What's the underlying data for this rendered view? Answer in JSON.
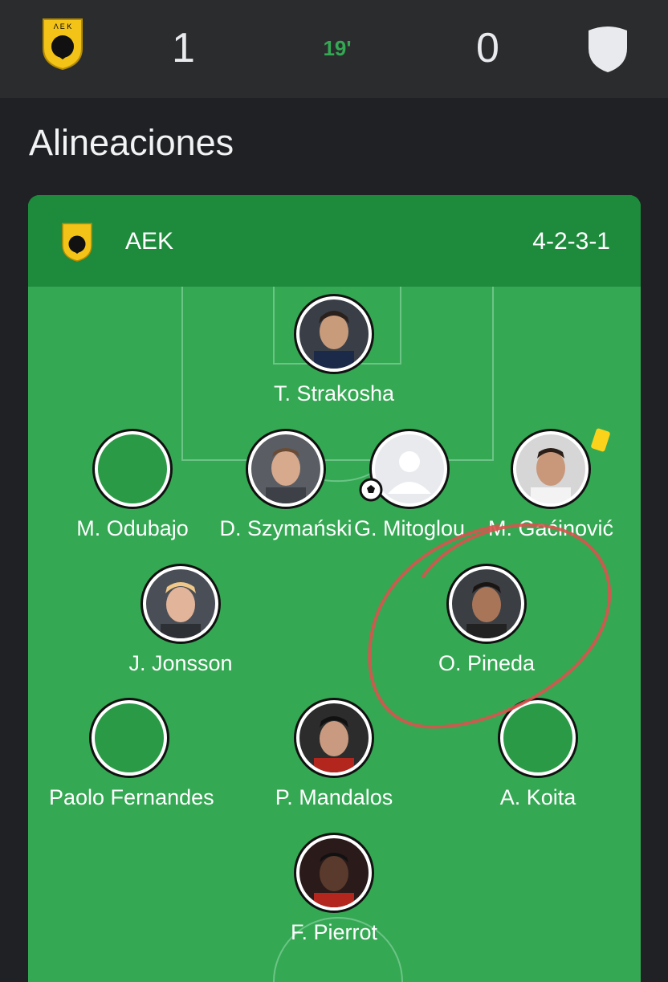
{
  "match": {
    "home_score": "1",
    "away_score": "0",
    "minute": "19'",
    "home_crest_icon": "aek-crest-icon",
    "away_crest_icon": "shield-placeholder-icon"
  },
  "section_title": "Alineaciones",
  "lineup": {
    "team": "AEK",
    "formation": "4-2-3-1",
    "header_color": "#1e8a3c",
    "pitch_color": "#34a853",
    "players": {
      "goalkeeper": "T. Strakosha",
      "def_1": "M. Odubajo",
      "def_2": "D. Szymański",
      "def_3": "G. Mitoglou",
      "def_4": "M. Gaćinović",
      "mid_1": "J. Jonsson",
      "mid_2": "O. Pineda",
      "att_1": "Paolo Fernandes",
      "att_2": "P. Mandalos",
      "att_3": "A. Koita",
      "forward": "F. Pierrot"
    }
  },
  "colors": {
    "accent_green": "#34a853",
    "yellow_card": "#fbd31b",
    "annotation_red": "#d9534f"
  }
}
